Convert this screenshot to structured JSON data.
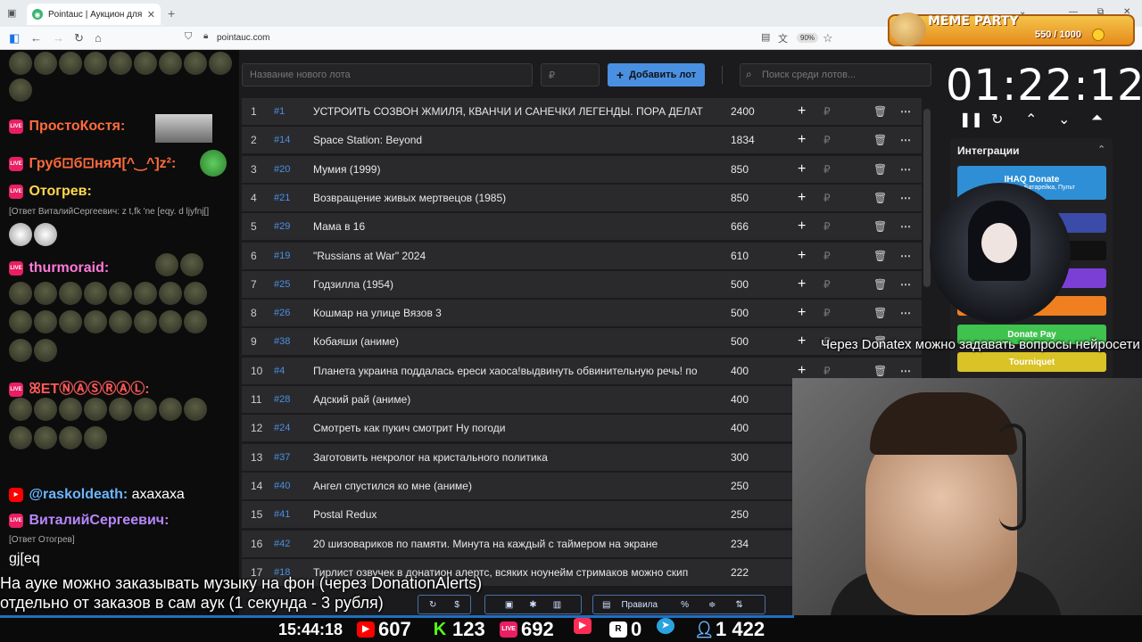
{
  "browser": {
    "tab_title": "Pointauc | Аукцион для стрим",
    "tab_close": "✕",
    "new_tab": "+",
    "url": "pointauc.com",
    "zoom": "90%",
    "controls": {
      "minimize": "⌄",
      "maximize": "—",
      "restore": "⧉",
      "close": "✕"
    }
  },
  "meme_party": {
    "title": "MEME PARTY",
    "progress": "550 / 1000"
  },
  "chat": {
    "messages": [
      {
        "user": "ПростоКостя:",
        "color": "#ff6b3d"
      },
      {
        "user": "Груб⊡б⊡няЯ[^‿^]z²:",
        "color": "#ff6b3d"
      },
      {
        "user": "Отогрев:",
        "color": "#ffd84a"
      },
      {
        "user": "thurmoraid:",
        "color": "#ff7ad9"
      },
      {
        "user": "ꕤETⓃⒶⓈⓇⒶⓁ:",
        "color": "#ff5a5a"
      },
      {
        "user": "@raskoldeath:",
        "text": "ахахаха",
        "color": "#6bb6ff"
      },
      {
        "user": "ВиталийСергеевич:",
        "color": "#b987ff"
      }
    ],
    "reply_1": "[Ответ ВиталийСергеевич: z t,fk 'ne [eqy. d ljyfnj[]",
    "reply_2": "[Ответ Отогрев]",
    "last_text": "gj[eq"
  },
  "auction": {
    "new_lot_placeholder": "Название нового лота",
    "amount_placeholder": "₽",
    "add_button": "Добавить лот",
    "search_placeholder": "Поиск среди лотов...",
    "currency": "₽",
    "lots": [
      {
        "n": "1",
        "id": "#1",
        "name": "УСТРОИТЬ СОЗВОН ЖМИЛЯ, КВАНЧИ И САНЕЧКИ ЛЕГЕНДЫ. ПОРА ДЕЛАТ",
        "amount": "2400"
      },
      {
        "n": "2",
        "id": "#14",
        "name": "Space Station: Beyond",
        "amount": "1834"
      },
      {
        "n": "3",
        "id": "#20",
        "name": "Мумия (1999)",
        "amount": "850"
      },
      {
        "n": "4",
        "id": "#21",
        "name": "Возвращение живых мертвецов (1985)",
        "amount": "850"
      },
      {
        "n": "5",
        "id": "#29",
        "name": "Мама в 16",
        "amount": "666"
      },
      {
        "n": "6",
        "id": "#19",
        "name": "\"Russians at War\" 2024",
        "amount": "610"
      },
      {
        "n": "7",
        "id": "#25",
        "name": "Годзилла (1954)",
        "amount": "500"
      },
      {
        "n": "8",
        "id": "#26",
        "name": "Кошмар на улице Вязов 3",
        "amount": "500"
      },
      {
        "n": "9",
        "id": "#38",
        "name": "Кобаяши (аниме)",
        "amount": "500"
      },
      {
        "n": "10",
        "id": "#4",
        "name": "Планета украина поддалась ереси хаоса!выдвинуть обвинительную речь! по",
        "amount": "400"
      },
      {
        "n": "11",
        "id": "#28",
        "name": "Адский рай (аниме)",
        "amount": "400"
      },
      {
        "n": "12",
        "id": "#24",
        "name": "Смотреть как пукич смотрит Ну погоди",
        "amount": "400"
      },
      {
        "n": "13",
        "id": "#37",
        "name": "Заготовить некролог на кристального политика",
        "amount": "300"
      },
      {
        "n": "14",
        "id": "#40",
        "name": "Ангел спустился ко мне (аниме)",
        "amount": "250"
      },
      {
        "n": "15",
        "id": "#41",
        "name": "Postal Redux",
        "amount": "250"
      },
      {
        "n": "16",
        "id": "#42",
        "name": "20 шизовариков по памяти. Минута на каждый с таймером на экране",
        "amount": "234"
      },
      {
        "n": "17",
        "id": "#18",
        "name": "Тирлист озвучек в донатион алертс, всяких ноунейм стримаков можно скип",
        "amount": "222"
      }
    ]
  },
  "timer": {
    "value": "01:22:12"
  },
  "integrations": {
    "title": "Интеграции",
    "buttons": [
      {
        "label": "IHAQ Donate",
        "sub": "Вид... отаж, Батарейка, Пульт",
        "color": "#2e8fd6"
      },
      {
        "label": "er",
        "color": "#3b4ba8"
      },
      {
        "label": "",
        "color": "#111111"
      },
      {
        "label": "",
        "color": "#7b3fd6"
      },
      {
        "label": "lerts",
        "color": "#f07f1f"
      },
      {
        "label": "Donate Pay",
        "color": "#3fc24e"
      },
      {
        "label": "Tourniquet",
        "color": "#d9c326"
      }
    ]
  },
  "toolbar": {
    "rules": "Правила"
  },
  "captions": {
    "right": "Через Donatex можно задавать вопросы нейросети",
    "bottom_1": "На ауке можно заказывать музыку на фон (через DonationAlerts)",
    "bottom_2": "отдельно от заказов в сам аук (1 секунда - 3 рубля)"
  },
  "status": {
    "time": "15:44:18",
    "youtube": "607",
    "kick": "123",
    "live": "692",
    "r": "0",
    "viewers": "1 422"
  },
  "colors": {
    "accent": "#4a90e2",
    "lot_bg": "#2a2a2d",
    "app_bg": "#1b1b1d"
  }
}
